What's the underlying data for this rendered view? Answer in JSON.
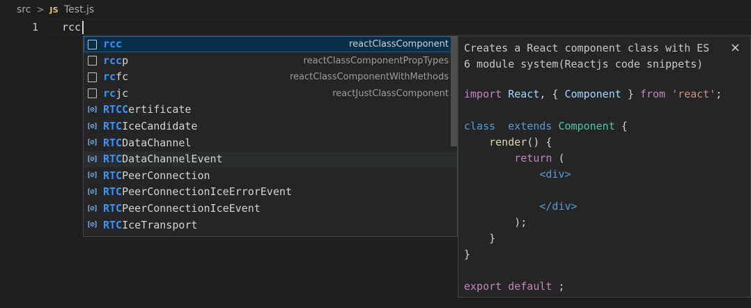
{
  "breadcrumbs": {
    "folder": "src",
    "separator": ">",
    "file_icon": "JS",
    "file": "Test.js"
  },
  "editor": {
    "line_number": "1",
    "text": "rcc"
  },
  "suggestions": [
    {
      "pre": "",
      "hl": "rcc",
      "post": "",
      "detail": "reactClassComponent",
      "icon": "snippet-icon",
      "state": "selected"
    },
    {
      "pre": "",
      "hl": "rcc",
      "post": "p",
      "detail": "reactClassComponentPropTypes",
      "icon": "snippet-icon",
      "state": ""
    },
    {
      "pre": "",
      "hl": "rc",
      "post": "fc",
      "detail": "reactClassComponentWithMethods",
      "icon": "snippet-icon",
      "state": ""
    },
    {
      "pre": "",
      "hl": "rc",
      "post": "jc",
      "detail": "reactJustClassComponent",
      "icon": "snippet-icon",
      "state": ""
    },
    {
      "pre": "",
      "hl": "RTCC",
      "post": "ertificate",
      "detail": "",
      "icon": "variable-icon",
      "state": ""
    },
    {
      "pre": "",
      "hl": "RTC",
      "post": "IceCandidate",
      "detail": "",
      "icon": "variable-icon",
      "state": ""
    },
    {
      "pre": "",
      "hl": "RTC",
      "post": "DataChannel",
      "detail": "",
      "icon": "variable-icon",
      "state": ""
    },
    {
      "pre": "",
      "hl": "RTC",
      "post": "DataChannelEvent",
      "detail": "",
      "icon": "variable-icon",
      "state": "hover"
    },
    {
      "pre": "",
      "hl": "RTC",
      "post": "PeerConnection",
      "detail": "",
      "icon": "variable-icon",
      "state": ""
    },
    {
      "pre": "",
      "hl": "RTC",
      "post": "PeerConnectionIceErrorEvent",
      "detail": "",
      "icon": "variable-icon",
      "state": ""
    },
    {
      "pre": "",
      "hl": "RTC",
      "post": "PeerConnectionIceEvent",
      "detail": "",
      "icon": "variable-icon",
      "state": ""
    },
    {
      "pre": "",
      "hl": "RTC",
      "post": "IceTransport",
      "detail": "",
      "icon": "variable-icon",
      "state": ""
    }
  ],
  "docs": {
    "close": "×",
    "description_line1": "Creates a React component class with ES",
    "description_line2": "6 module system(Reactjs code snippets)",
    "code": {
      "import_kw": "import",
      "react": "React",
      "comma_brace": ", {",
      "component": "Component",
      "close_brace": "}",
      "from_kw": "from",
      "module_str": "'react'",
      "semicolon": ";",
      "class_kw": "class",
      "extends_kw": "extends",
      "base_class": "Component",
      "open_brace": "{",
      "render_fn": "render",
      "render_parens": "() {",
      "return_kw": "return",
      "return_paren": "(",
      "div_open": "<div>",
      "div_close": "</div>",
      "close_paren_semi": ");",
      "inner_close": "}",
      "outer_close": "}",
      "export_kw": "export",
      "default_kw": "default",
      "export_semi": ";"
    }
  }
}
